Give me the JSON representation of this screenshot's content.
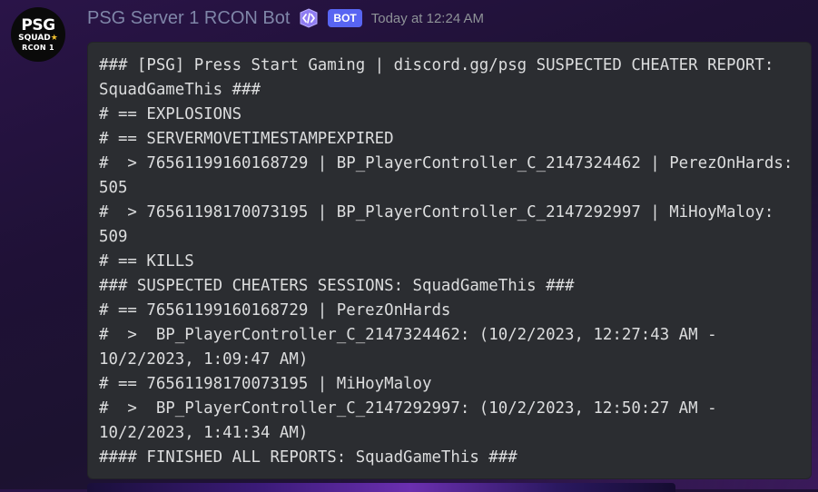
{
  "message": {
    "avatar": {
      "line1": "PSG",
      "line2": "SQUAD",
      "line3": "RCON 1"
    },
    "username": "PSG Server 1 RCON Bot",
    "app_icon": "code-brackets-icon",
    "bot_tag": "BOT",
    "timestamp": "Today at 12:24 AM",
    "code_lines": [
      "### [PSG] Press Start Gaming | discord.gg/psg SUSPECTED CHEATER REPORT: SquadGameThis ###",
      "# == EXPLOSIONS",
      "# == SERVERMOVETIMESTAMPEXPIRED",
      "#  > 76561199160168729 | BP_PlayerController_C_2147324462 | PerezOnHards: 505",
      "#  > 76561198170073195 | BP_PlayerController_C_2147292997 | MiHoyMaloy: 509",
      "# == KILLS",
      "### SUSPECTED CHEATERS SESSIONS: SquadGameThis ###",
      "# == 76561199160168729 | PerezOnHards",
      "#  >  BP_PlayerController_C_2147324462: (10/2/2023, 12:27:43 AM - 10/2/2023, 1:09:47 AM)",
      "# == 76561198170073195 | MiHoyMaloy",
      "#  >  BP_PlayerController_C_2147292997: (10/2/2023, 12:50:27 AM - 10/2/2023, 1:41:34 AM)",
      "#### FINISHED ALL REPORTS: SquadGameThis ###"
    ]
  },
  "colors": {
    "username": "#7f86a8",
    "bot_tag": "#5865f2",
    "code_bg": "#2b2d31"
  }
}
